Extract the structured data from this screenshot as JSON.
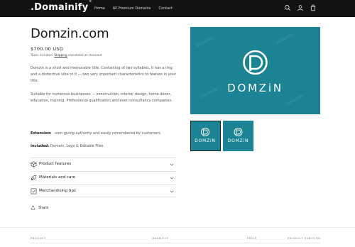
{
  "header": {
    "logo": ".Domainify",
    "logo_mark": "®",
    "nav": [
      "Home",
      "All Premium Domains",
      "Contact"
    ],
    "icons": [
      "search-icon",
      "account-icon",
      "cart-icon"
    ]
  },
  "product": {
    "title": "Domzin.com",
    "price": "$700.00 USD",
    "tax_prefix": "Taxes included.",
    "tax_link": "Shipping",
    "tax_suffix": "calculated at checkout.",
    "description_1": "Domzin is a short and memorable title. Containing of two syllables, it has a ring and a distinctive vibe to it — two very important characteristics to feature in your title.",
    "description_2": "Suitable for numerous businesses — construction, interior design, home décor, education, training. Professional qualification and even consultancy companies.",
    "extension_label": "Extension:",
    "extension_text": ".com giving authority and easily remembered by customers.",
    "included_label": "Included:",
    "included_text": "Domain, Logo & Editable Files."
  },
  "accordion": [
    {
      "label": "Product features",
      "icon": "box-icon"
    },
    {
      "label": "Materials and care",
      "icon": "leaf-icon"
    },
    {
      "label": "Merchandising tips",
      "icon": "checkbox-icon"
    }
  ],
  "share_label": "Share",
  "image": {
    "brand_text": "DOMZiN",
    "watermark": "Domainify",
    "bg_color": "#1b8394"
  },
  "cart_table": {
    "headers": [
      "PRODUCT",
      "QUANTITY",
      "PRICE",
      "PRODUCT SUBTOTAL"
    ]
  }
}
